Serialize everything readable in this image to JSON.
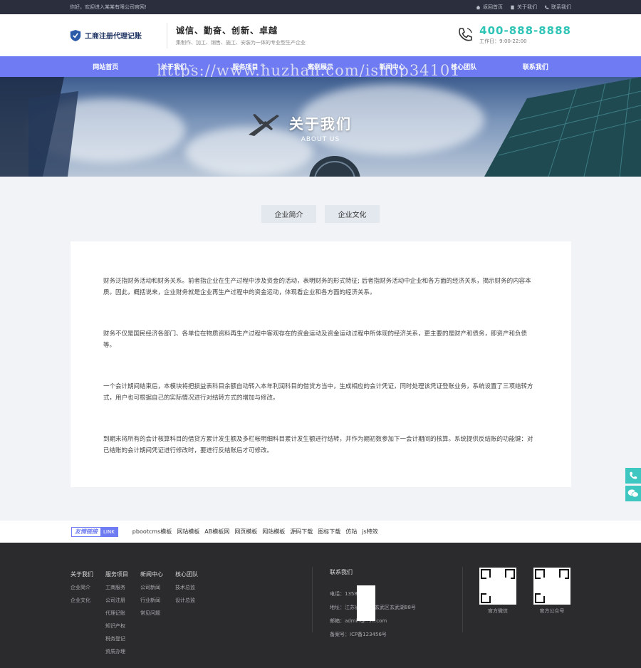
{
  "topbar": {
    "welcome": "你好，欢迎进入某某有限公司官网!",
    "links": [
      "返回首页",
      "关于我们",
      "联系我们"
    ]
  },
  "header": {
    "logo_text": "工商注册代理记账",
    "slogan": "诚信、勤奋、创新、卓越",
    "slogan_sub": "集制作、加工、销售、施工、安装为一体的专业型生产企业",
    "hotline": "400-888-8888",
    "hours": "工作日：9:00-22:00"
  },
  "nav": {
    "items": [
      "网站首页",
      "关于我们",
      "服务项目",
      "案例展示",
      "新闻中心",
      "核心团队",
      "联系我们"
    ],
    "watermark": "https://www.huzhan.com/ishop34101"
  },
  "banner": {
    "title": "关于我们",
    "subtitle": "ABOUT US"
  },
  "tabs": [
    "企业简介",
    "企业文化"
  ],
  "content": {
    "paragraphs": [
      "财务泛指财务活动和财务关系。前者指企业在生产过程中涉及资金的活动，表明财务的形式特征; 后者指财务活动中企业和各方面的经济关系，揭示财务的内容本质。因此，概括说来，企业财务就是企业再生产过程中的资金运动，体现看企业和各方面的经济关系。",
      "财务不仅是国民经济各部门、各单位在物质资料再生产过程中客观存在的资金运动及资金运动过程中所体现的经济关系，更主要的是财产和债务，即资产和负债等。",
      "一个会计期间结束后，本模块将把损益表科目余额自动转入本年利润科目的借贷方当中，生成相应的会计凭证，同时处理该凭证登账业务，系统设置了三项结转方式，用户也可根据自己的实际情况进行对结转方式的增加与修改。",
      "到期末将所有的会计核算科目的借贷方累计发生额及多栏帐明细科目累计发生额进行结转，并作为期初数参加下一会计期间的核算。系统提供反结账的功能键：对已结账的会计期间凭证进行修改时，要进行反结账后才可修改。"
    ]
  },
  "friend": {
    "badge_cn": "友情链接",
    "badge_en": "LINK",
    "links": [
      "pbootcms模板",
      "网站模板",
      "AB模板网",
      "网页模板",
      "网站模板",
      "源码下载",
      "图标下载",
      "仿站",
      "js特效"
    ]
  },
  "footer": {
    "cols": [
      {
        "title": "关于我们",
        "items": [
          "企业简介",
          "企业文化"
        ]
      },
      {
        "title": "服务项目",
        "items": [
          "工商服务",
          "公司注册",
          "代理记账",
          "知识产权",
          "税务登记",
          "资质办理"
        ]
      },
      {
        "title": "新闻中心",
        "items": [
          "公司新闻",
          "行业新闻",
          "常见问题"
        ]
      },
      {
        "title": "核心团队",
        "items": [
          "技术总监",
          "设计总监"
        ]
      }
    ],
    "contact_title": "联系我们",
    "contact": [
      "电话：1358",
      "地址：江苏省南京市玄武区玄武湖88号",
      "邮箱：admin@...in.com",
      "备案号：ICP备123456号"
    ],
    "qr_labels": [
      "官方微信",
      "官方公众号"
    ]
  },
  "colors": {
    "nav": "#6e7bf2",
    "topbar": "#2b2e3d",
    "hotline": "#2ec4b6",
    "float": "#3ec6c0",
    "footer": "#2b2b2e"
  }
}
